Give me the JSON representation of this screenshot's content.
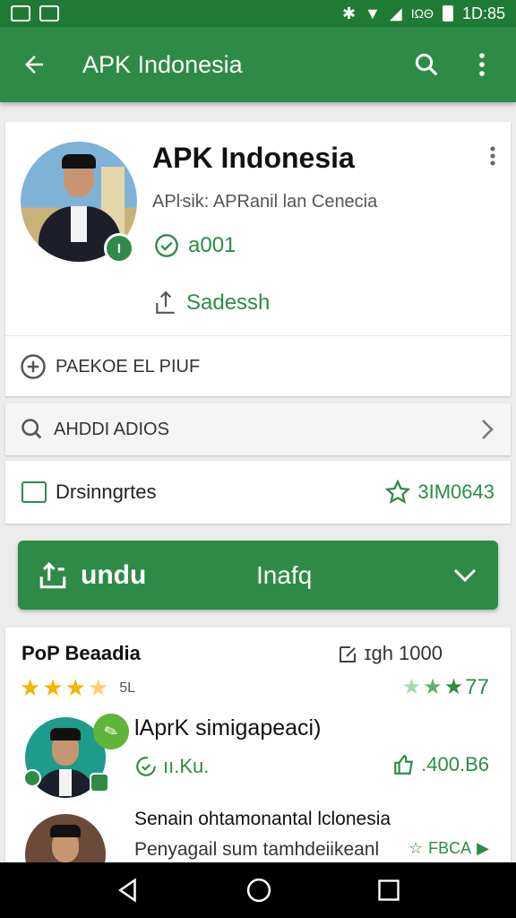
{
  "status_bar": {
    "time": "1D:85",
    "network": "ΙΩΘ",
    "icons": [
      "image-icon",
      "image-icon",
      "bluetooth-icon",
      "wifi-icon",
      "signal-icon",
      "battery-icon"
    ]
  },
  "appbar": {
    "title": "APK Indonesia",
    "icons": [
      "back-arrow-icon",
      "search-icon",
      "more-vert-icon"
    ]
  },
  "profile": {
    "name": "APK Indonesia",
    "subtitle": "APŀsik: APRanil lan Cenecia",
    "version": "a001",
    "share_label": "Sadessh",
    "package_label": "PAEKOE EL PIUF"
  },
  "search": {
    "label": "AHDDI ADIOS"
  },
  "description": {
    "label": "Drsinngrtes",
    "value": "3IM0643"
  },
  "download_button": {
    "label": "undu",
    "info": "Inafq"
  },
  "reviews": {
    "title": "PoP Beaadia",
    "count": "ɪgh 1000",
    "star_rating": 3.5,
    "star_count": "5L",
    "score": "77",
    "item1_title": "lAprK simigapeaci)",
    "item1_meta": "ıı.Ku.",
    "item1_stat": ".400.B6",
    "item2_title": "Senain ohtamonantal lclonesia",
    "item2_subtitle": "Penyagail sum tamhdeiikeanl",
    "item2_stat": "FBCA"
  },
  "colors": {
    "primary": "#2e8b47",
    "status_bar": "#1f7a36",
    "star": "#f4b400"
  }
}
